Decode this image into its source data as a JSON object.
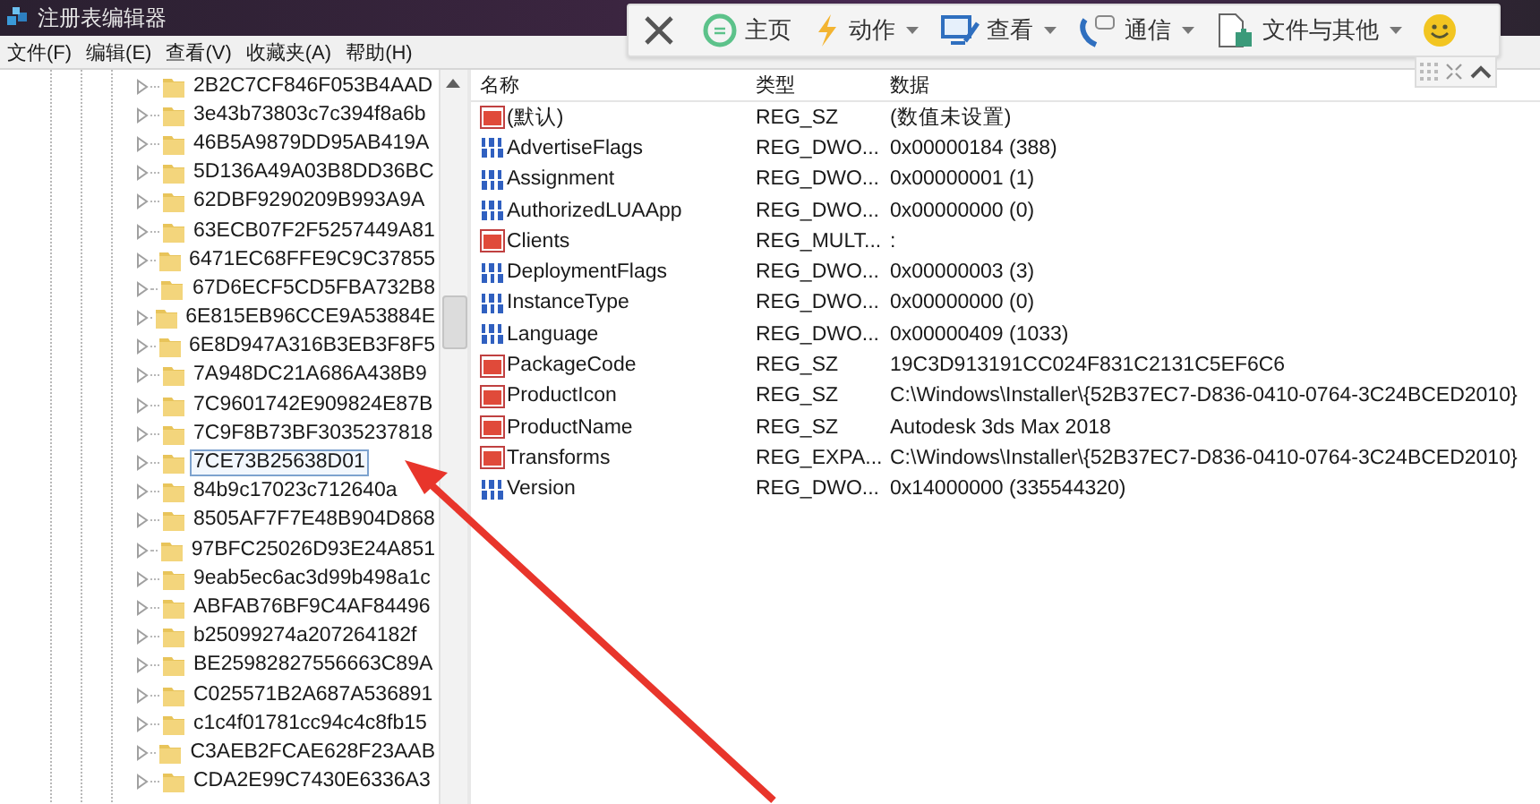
{
  "window": {
    "title": "注册表编辑器"
  },
  "menu": [
    "文件(F)",
    "编辑(E)",
    "查看(V)",
    "收藏夹(A)",
    "帮助(H)"
  ],
  "toolbar": {
    "items": [
      {
        "kind": "home",
        "label": "主页",
        "dropdown": false
      },
      {
        "kind": "action",
        "label": "动作",
        "dropdown": true
      },
      {
        "kind": "view",
        "label": "查看",
        "dropdown": true
      },
      {
        "kind": "comm",
        "label": "通信",
        "dropdown": true
      },
      {
        "kind": "file",
        "label": "文件与其他",
        "dropdown": true
      }
    ]
  },
  "tree": {
    "items": [
      {
        "label": "2B2C7CF846F053B4AAD",
        "selected": false
      },
      {
        "label": "3e43b73803c7c394f8a6b",
        "selected": false
      },
      {
        "label": "46B5A9879DD95AB419A",
        "selected": false
      },
      {
        "label": "5D136A49A03B8DD36BC",
        "selected": false
      },
      {
        "label": "62DBF9290209B993A9A",
        "selected": false
      },
      {
        "label": "63ECB07F2F5257449A81",
        "selected": false
      },
      {
        "label": "6471EC68FFE9C9C37855",
        "selected": false
      },
      {
        "label": "67D6ECF5CD5FBA732B8",
        "selected": false
      },
      {
        "label": "6E815EB96CCE9A53884E",
        "selected": false
      },
      {
        "label": "6E8D947A316B3EB3F8F5",
        "selected": false
      },
      {
        "label": "7A948DC21A686A438B9",
        "selected": false
      },
      {
        "label": "7C9601742E909824E87B",
        "selected": false
      },
      {
        "label": "7C9F8B73BF3035237818",
        "selected": false
      },
      {
        "label": "7CE73B25638D01",
        "selected": true
      },
      {
        "label": "84b9c17023c712640a",
        "selected": false
      },
      {
        "label": "8505AF7F7E48B904D868",
        "selected": false
      },
      {
        "label": "97BFC25026D93E24A851",
        "selected": false
      },
      {
        "label": "9eab5ec6ac3d99b498a1c",
        "selected": false
      },
      {
        "label": "ABFAB76BF9C4AF84496",
        "selected": false
      },
      {
        "label": "b25099274a207264182f",
        "selected": false
      },
      {
        "label": "BE25982827556663C89A",
        "selected": false
      },
      {
        "label": "C025571B2A687A536891",
        "selected": false
      },
      {
        "label": "c1c4f01781cc94c4c8fb15",
        "selected": false
      },
      {
        "label": "C3AEB2FCAE628F23AAB",
        "selected": false
      },
      {
        "label": "CDA2E99C7430E6336A3",
        "selected": false
      }
    ]
  },
  "table": {
    "columns": [
      "名称",
      "类型",
      "数据"
    ],
    "rows": [
      {
        "kind": "sz",
        "name": "(默认)",
        "type": "REG_SZ",
        "data": "(数值未设置)"
      },
      {
        "kind": "dword",
        "name": "AdvertiseFlags",
        "type": "REG_DWO...",
        "data": "0x00000184 (388)"
      },
      {
        "kind": "dword",
        "name": "Assignment",
        "type": "REG_DWO...",
        "data": "0x00000001 (1)"
      },
      {
        "kind": "dword",
        "name": "AuthorizedLUAApp",
        "type": "REG_DWO...",
        "data": "0x00000000 (0)"
      },
      {
        "kind": "sz",
        "name": "Clients",
        "type": "REG_MULT...",
        "data": ":"
      },
      {
        "kind": "dword",
        "name": "DeploymentFlags",
        "type": "REG_DWO...",
        "data": "0x00000003 (3)"
      },
      {
        "kind": "dword",
        "name": "InstanceType",
        "type": "REG_DWO...",
        "data": "0x00000000 (0)"
      },
      {
        "kind": "dword",
        "name": "Language",
        "type": "REG_DWO...",
        "data": "0x00000409 (1033)"
      },
      {
        "kind": "sz",
        "name": "PackageCode",
        "type": "REG_SZ",
        "data": "19C3D913191CC024F831C2131C5EF6C6"
      },
      {
        "kind": "sz",
        "name": "ProductIcon",
        "type": "REG_SZ",
        "data": "C:\\Windows\\Installer\\{52B37EC7-D836-0410-0764-3C24BCED2010}"
      },
      {
        "kind": "sz",
        "name": "ProductName",
        "type": "REG_SZ",
        "data": "Autodesk 3ds Max 2018"
      },
      {
        "kind": "sz",
        "name": "Transforms",
        "type": "REG_EXPA...",
        "data": "C:\\Windows\\Installer\\{52B37EC7-D836-0410-0764-3C24BCED2010}"
      },
      {
        "kind": "dword",
        "name": "Version",
        "type": "REG_DWO...",
        "data": "0x14000000 (335544320)"
      }
    ]
  }
}
